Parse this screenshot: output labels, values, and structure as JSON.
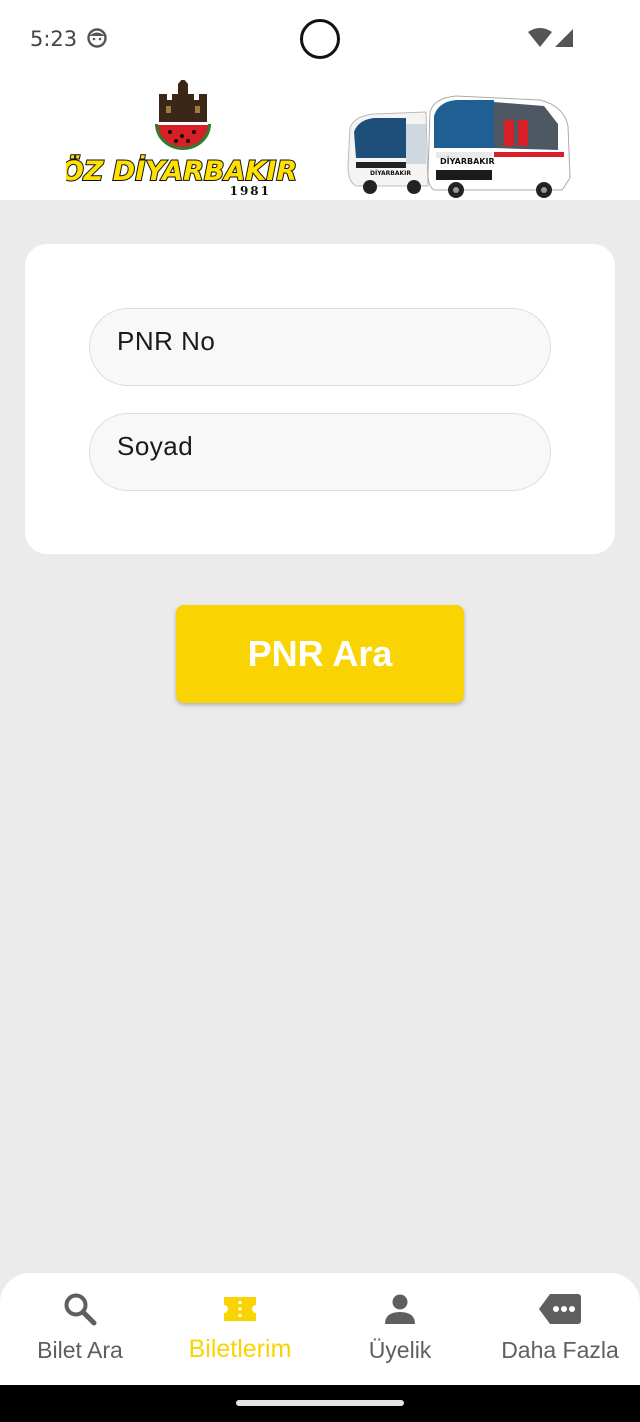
{
  "status_bar": {
    "time": "5:23",
    "icons": [
      "face-icon",
      "camera-hole",
      "wifi-icon",
      "signal-icon"
    ]
  },
  "header": {
    "logo": {
      "brand_text": "ÖZ DİYARBAKIR",
      "year": "1981"
    },
    "bus_image": {
      "bus_text": "DİYARBAKIR"
    }
  },
  "form": {
    "pnr_placeholder": "PNR No",
    "surname_placeholder": "Soyad"
  },
  "search_button": {
    "label": "PNR Ara"
  },
  "bottom_nav": {
    "items": [
      {
        "label": "Bilet Ara",
        "icon": "search-icon",
        "active": false
      },
      {
        "label": "Biletlerim",
        "icon": "ticket-icon",
        "active": true
      },
      {
        "label": "Üyelik",
        "icon": "person-icon",
        "active": false
      },
      {
        "label": "Daha Fazla",
        "icon": "more-icon",
        "active": false
      }
    ]
  },
  "colors": {
    "accent": "#fad402",
    "background": "#ebebeb",
    "nav_inactive": "#5f5f5f",
    "logo_yellow": "#ffe000"
  }
}
